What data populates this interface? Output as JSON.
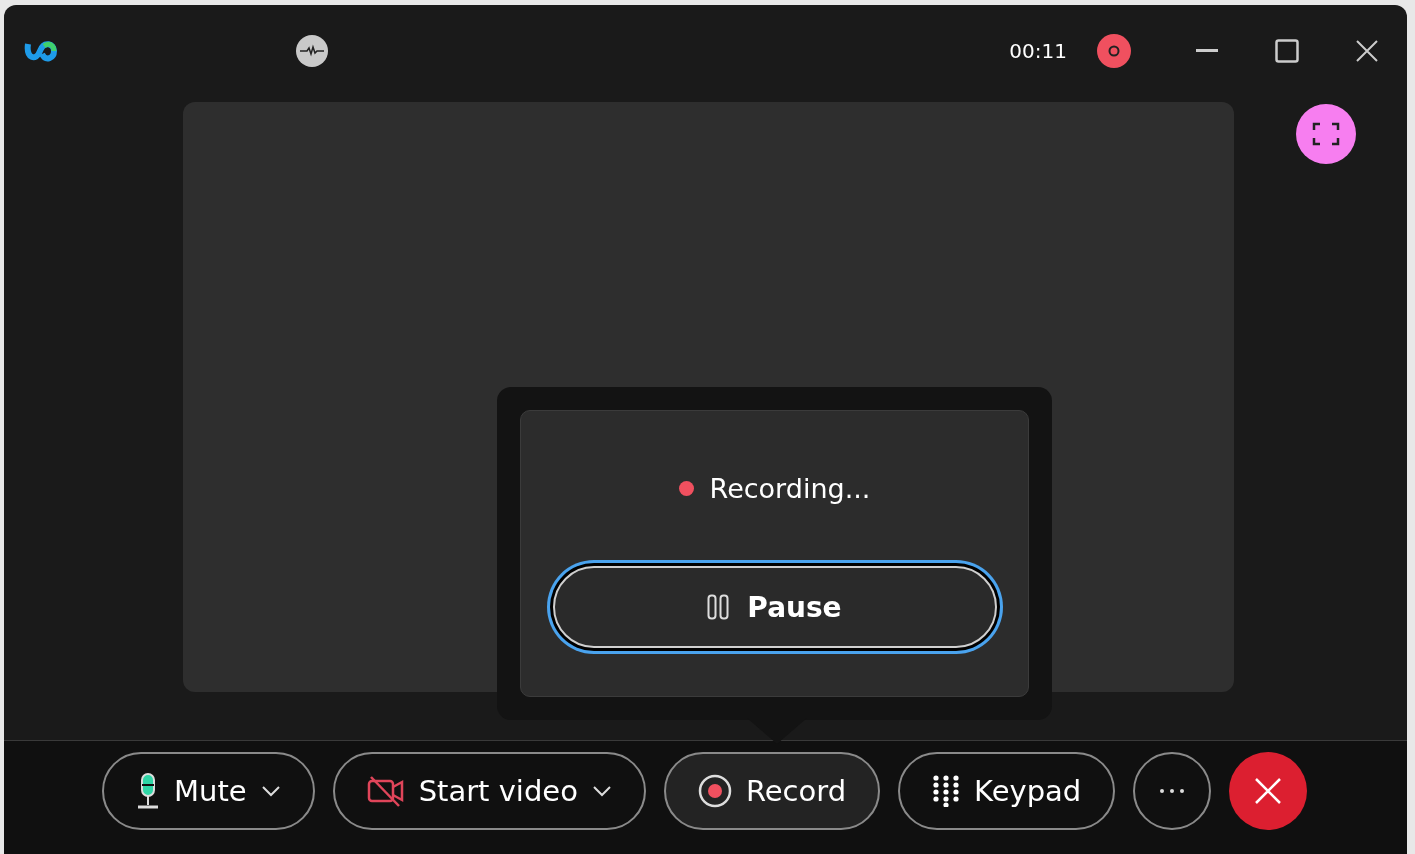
{
  "title_bar": {
    "timer": "00:11",
    "recording": true
  },
  "recording_popover": {
    "status": "Recording...",
    "pause_button": {
      "label": "Pause"
    }
  },
  "controls": [
    {
      "kind": "mic",
      "label": "Mute",
      "dropdown": true,
      "selected": false
    },
    {
      "kind": "video",
      "label": "Start video",
      "dropdown": true,
      "selected": false
    },
    {
      "kind": "record",
      "label": "Record",
      "dropdown": false,
      "selected": true
    },
    {
      "kind": "keypad",
      "label": "Keypad",
      "dropdown": false,
      "selected": false
    },
    {
      "kind": "more",
      "selected": false
    },
    {
      "kind": "end",
      "selected": false
    }
  ]
}
